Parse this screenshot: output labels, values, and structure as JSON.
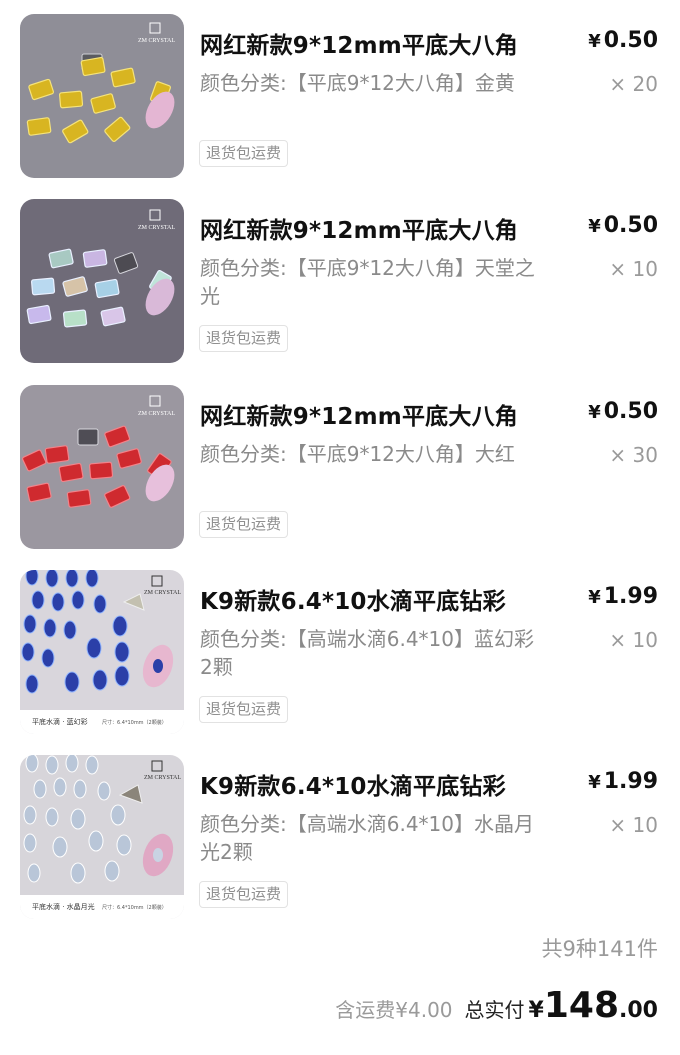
{
  "items": [
    {
      "title": "网红新款9*12mm平底大八角",
      "price_symbol": "¥",
      "price": "0.50",
      "spec": "颜色分类:【平底9*12大八角】金黄",
      "qty": "× 20",
      "badge": "退货包运费",
      "image": {
        "watermark": "ZM CRYSTAL",
        "bg": "#8f8e97",
        "stone": "#d8b521"
      }
    },
    {
      "title": "网红新款9*12mm平底大八角",
      "price_symbol": "¥",
      "price": "0.50",
      "spec": "颜色分类:【平底9*12大八角】天堂之光",
      "qty": "× 10",
      "badge": "退货包运费",
      "image": {
        "watermark": "ZM CRYSTAL",
        "bg": "#6f6b78",
        "stone": "#b7d6c9"
      }
    },
    {
      "title": "网红新款9*12mm平底大八角",
      "price_symbol": "¥",
      "price": "0.50",
      "spec": "颜色分类:【平底9*12大八角】大红",
      "qty": "× 30",
      "badge": "退货包运费",
      "image": {
        "watermark": "ZM CRYSTAL",
        "bg": "#9b97a0",
        "stone": "#cf2a2f"
      }
    },
    {
      "title": "K9新款6.4*10水滴平底钻彩",
      "price_symbol": "¥",
      "price": "1.99",
      "spec": "颜色分类:【高端水滴6.4*10】蓝幻彩2颗",
      "qty": "× 10",
      "badge": "退货包运费",
      "image": {
        "watermark": "ZM CRYSTAL",
        "bg": "#d9d6dc",
        "stone": "#2b3fa8",
        "caption": "平底水滴 · 蓝幻彩",
        "size_note": "尺寸：6.4*10mm（2颗装）"
      }
    },
    {
      "title": "K9新款6.4*10水滴平底钻彩",
      "price_symbol": "¥",
      "price": "1.99",
      "spec": "颜色分类:【高端水滴6.4*10】水晶月光2颗",
      "qty": "× 10",
      "badge": "退货包运费",
      "image": {
        "watermark": "ZM CRYSTAL",
        "bg": "#d7d5da",
        "stone": "#b9c6d8",
        "caption": "平底水滴 · 水晶月光",
        "size_note": "尺寸：6.4*10mm（2颗装）"
      }
    }
  ],
  "summary": {
    "count_text": "共9种141件",
    "shipping_text": "含运费¥4.00",
    "total_label": "总实付",
    "currency": "¥",
    "total_int": "148",
    "total_dec": ".00"
  }
}
